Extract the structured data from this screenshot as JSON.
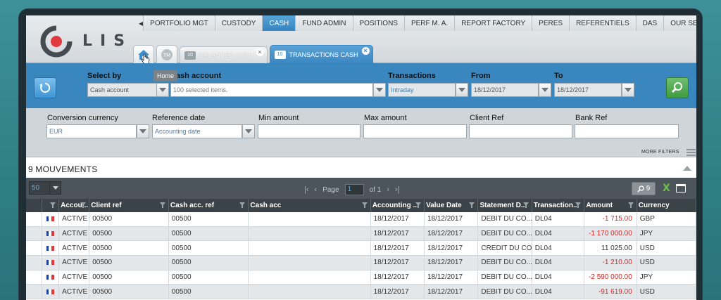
{
  "app": {
    "logo_text": "LIS"
  },
  "topnav": {
    "items": [
      "PORTFOLIO MGT",
      "CUSTODY",
      "CASH",
      "FUND ADMIN",
      "POSITIONS",
      "PERF M. A.",
      "REPORT FACTORY",
      "PERES",
      "REFERENTIELS",
      "DAS",
      "OUR SERVIC"
    ],
    "active_index": 2
  },
  "tabs": {
    "home_tooltip": "Home",
    "tm_label": "TM",
    "items": [
      {
        "label": "BALANCES CASH",
        "icon_text": "10",
        "active": false
      },
      {
        "label": "TRANSACTIONS CASH",
        "icon_text": "10",
        "active": true
      }
    ]
  },
  "filters": {
    "select_by": {
      "label": "Select by",
      "value": "Cash account"
    },
    "cash_account": {
      "label": "Cash account",
      "value": "100 selected items."
    },
    "transactions": {
      "label": "Transactions",
      "value": "Intraday"
    },
    "from": {
      "label": "From",
      "value": "18/12/2017"
    },
    "to": {
      "label": "To",
      "value": "18/12/2017"
    },
    "conversion_currency": {
      "label": "Conversion currency",
      "value": "EUR"
    },
    "reference_date": {
      "label": "Reference date",
      "value": "Accounting date"
    },
    "min_amount": {
      "label": "Min amount",
      "value": ""
    },
    "max_amount": {
      "label": "Max amount",
      "value": ""
    },
    "client_ref": {
      "label": "Client Ref",
      "value": ""
    },
    "bank_ref": {
      "label": "Bank Ref",
      "value": ""
    },
    "more_filters": "MORE FILTERS"
  },
  "results": {
    "title": "9 MOUVEMENTS",
    "page_size": "50",
    "page_label": "Page",
    "page_value": "1",
    "of_label": "of 1",
    "count": "9",
    "columns": [
      "",
      "Accou...",
      "Client ref",
      "Cash acc. ref",
      "Cash acc",
      "Accounting ...",
      "Value Date",
      "Statement D...",
      "Transaction...",
      "Amount",
      "Currency"
    ],
    "rows": [
      {
        "status": "ACTIVE",
        "client_ref": "00500",
        "cash_acc_ref": "00500",
        "cash_acc": "",
        "accounting": "18/12/2017",
        "value_date": "18/12/2017",
        "statement": "DEBIT DU CO...",
        "transaction": "DL04",
        "amount": "-1 715.00",
        "negative": true,
        "currency": "GBP"
      },
      {
        "status": "ACTIVE",
        "client_ref": "00500",
        "cash_acc_ref": "00500",
        "cash_acc": "",
        "accounting": "18/12/2017",
        "value_date": "18/12/2017",
        "statement": "DEBIT DU CO...",
        "transaction": "DL04",
        "amount": "-1 170 000.00",
        "negative": true,
        "currency": "JPY"
      },
      {
        "status": "ACTIVE",
        "client_ref": "00500",
        "cash_acc_ref": "00500",
        "cash_acc": "",
        "accounting": "18/12/2017",
        "value_date": "18/12/2017",
        "statement": "CREDIT DU CO...",
        "transaction": "DL04",
        "amount": "11 025.00",
        "negative": false,
        "currency": "USD"
      },
      {
        "status": "ACTIVE",
        "client_ref": "00500",
        "cash_acc_ref": "00500",
        "cash_acc": "",
        "accounting": "18/12/2017",
        "value_date": "18/12/2017",
        "statement": "DEBIT DU CO...",
        "transaction": "DL04",
        "amount": "-1 210.00",
        "negative": true,
        "currency": "USD"
      },
      {
        "status": "ACTIVE",
        "client_ref": "00500",
        "cash_acc_ref": "00500",
        "cash_acc": "",
        "accounting": "18/12/2017",
        "value_date": "18/12/2017",
        "statement": "DEBIT DU CO...",
        "transaction": "DL04",
        "amount": "-2 590 000.00",
        "negative": true,
        "currency": "JPY"
      },
      {
        "status": "ACTIVE",
        "client_ref": "00500",
        "cash_acc_ref": "00500",
        "cash_acc": "",
        "accounting": "18/12/2017",
        "value_date": "18/12/2017",
        "statement": "DEBIT DU CO...",
        "transaction": "DL04",
        "amount": "-91 619.00",
        "negative": true,
        "currency": "USD"
      }
    ]
  },
  "colors": {
    "accent_blue": "#3a87c0",
    "search_green": "#3f9a3f",
    "negative_red": "#e02020",
    "logo_red": "#e03a3e"
  }
}
